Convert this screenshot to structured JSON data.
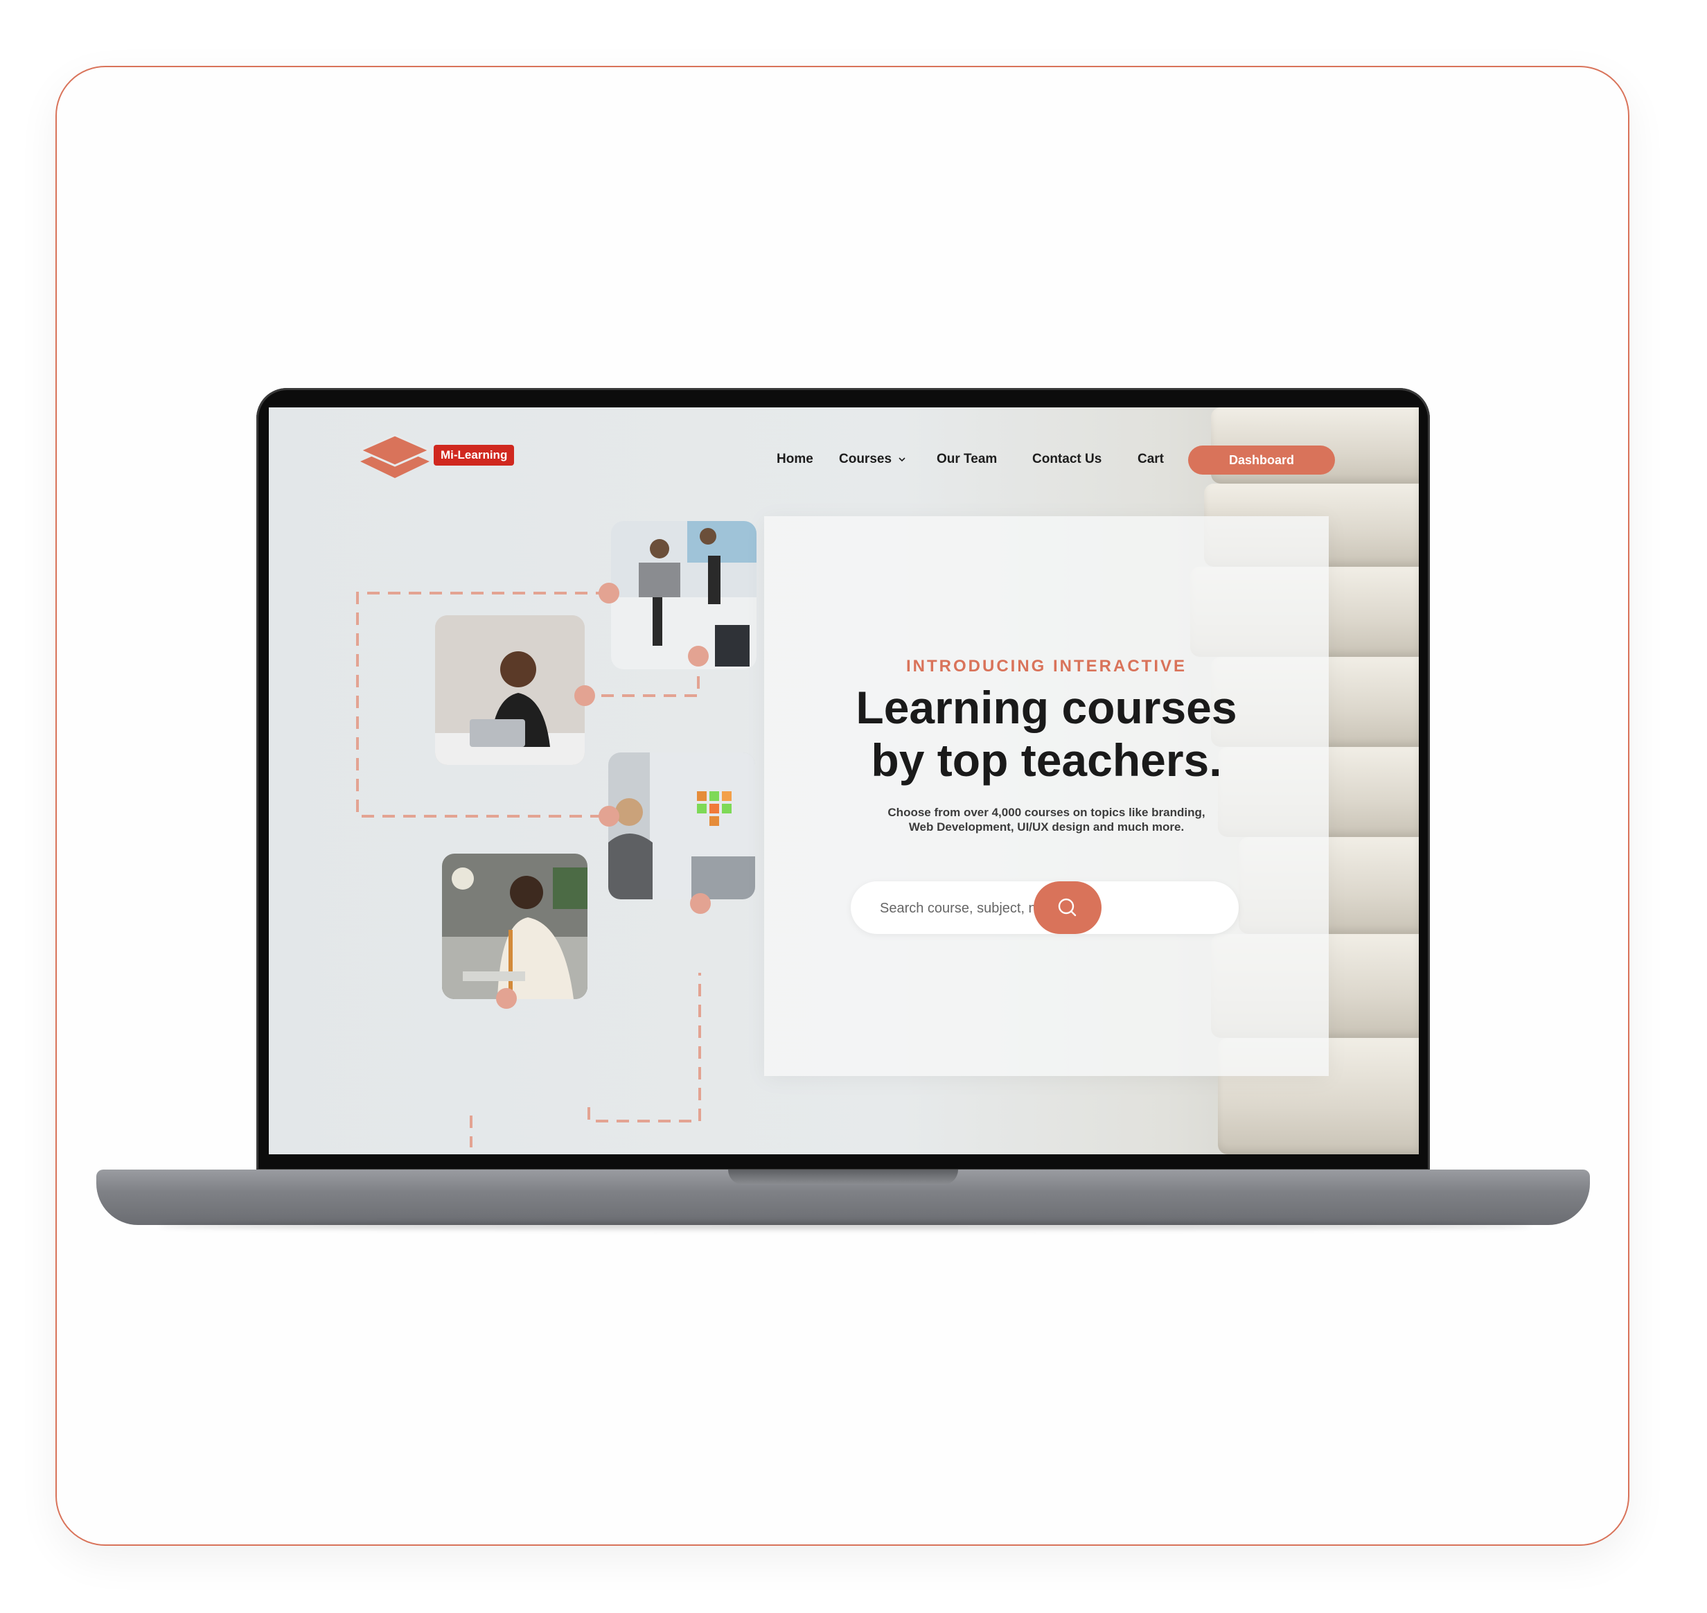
{
  "brand": {
    "name": "Mi-Learning",
    "accent": "#d9735a",
    "badge_color": "#d0281f"
  },
  "nav": {
    "home": "Home",
    "courses": "Courses",
    "our_team": "Our Team",
    "contact_us": "Contact Us",
    "cart": "Cart",
    "dashboard": "Dashboard"
  },
  "hero": {
    "eyebrow": "INTRODUCING INTERACTIVE",
    "headline_line1": "Learning courses",
    "headline_line2": "by top teachers.",
    "subtext_line1": "Choose from over 4,000 courses on topics like branding,",
    "subtext_line2": "Web Development, UI/UX design and much more."
  },
  "search": {
    "placeholder": "Search course, subject, name...",
    "button_icon": "search-icon"
  },
  "photos": [
    {
      "name": "photo-man-laptop"
    },
    {
      "name": "photo-office-desks"
    },
    {
      "name": "photo-woman-sticky-notes"
    },
    {
      "name": "photo-man-desk-lamp"
    }
  ]
}
